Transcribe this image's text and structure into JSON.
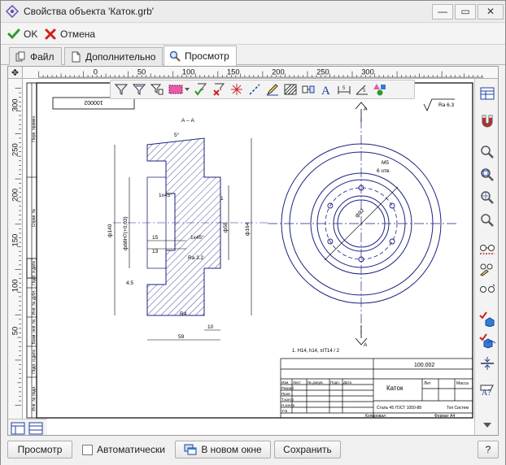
{
  "window": {
    "title": "Свойства объекта 'Каток.grb'",
    "minimize": "—",
    "maximize": "▭",
    "close": "✕"
  },
  "toolbar": {
    "ok_label": "OK",
    "cancel_label": "Отмена"
  },
  "tabs": [
    {
      "label": "Файл",
      "icon": "file-icon"
    },
    {
      "label": "Дополнительно",
      "icon": "page-icon"
    },
    {
      "label": "Просмотр",
      "icon": "magnifier-icon",
      "active": true
    }
  ],
  "rulers": {
    "horizontal": [
      "0",
      "50",
      "100",
      "150",
      "200",
      "250",
      "300"
    ],
    "vertical": [
      "300",
      "250",
      "200",
      "150",
      "100",
      "50"
    ]
  },
  "drawing": {
    "doc_code": "100.002",
    "doc_code_rotated": "100002",
    "section_label": "А – А",
    "section_mark": "А",
    "roughness_corner": "Ra 6.3",
    "roughness_note": "Ra 3.2",
    "angle": "5°",
    "chamfer_1": "1x45°",
    "chamfer_2": "1x45°",
    "dim_d140": "ф140",
    "dim_d68": "ф68Н7(+0,03)",
    "dim_d58": "ф58",
    "dim_d164": "ф164",
    "dim_15": "15",
    "dim_13": "13",
    "dim_45": "4.5",
    "dim_r4": "R4",
    "dim_10": "10",
    "dim_59": "59",
    "dim_1": "1",
    "thread": "М5",
    "holes": "6 отв.",
    "dim_d92": "ф92",
    "note": "1. Н14, h14, ±IT14 / 2",
    "part_name": "Каток",
    "material": "Сталь 45 ГОСТ 1050-88",
    "company": "Топ Систем",
    "stamp_rows": [
      "Изм",
      "Разраб",
      "Пров",
      "Т.контр",
      "Н.контр",
      "Утв"
    ],
    "stamp_cols": [
      "Лист",
      "№ докум.",
      "Подп.",
      "Дата"
    ],
    "lit": "Лит",
    "mass": "Масса",
    "copied": "Копировал",
    "format": "Формат  А4",
    "side_labels": [
      "Перв. примен.",
      "Справ. №",
      "Подп. и дата",
      "Инв. № дубл.",
      "Взам. инв. №",
      "Подп. и дата",
      "Инв. № подл."
    ]
  },
  "bottom": {
    "preview_label": "Просмотр",
    "auto_label": "Автоматически",
    "new_window_label": "В новом окне",
    "save_label": "Сохранить",
    "help_label": "?"
  },
  "colors": {
    "accent_blue": "#1c3fa0",
    "ok_green": "#2e9a2e",
    "cancel_red": "#d21f1f",
    "drawing_navy": "#1a237e"
  }
}
